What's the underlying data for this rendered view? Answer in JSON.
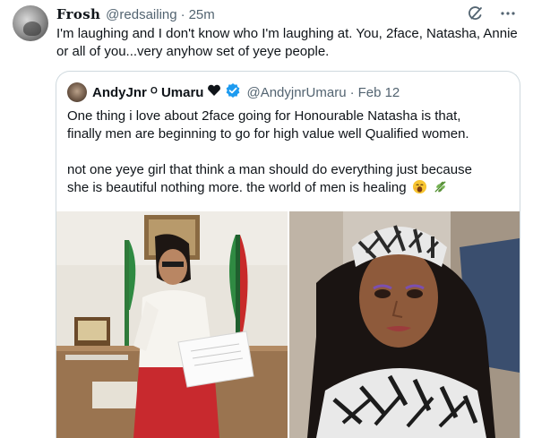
{
  "tweet": {
    "author_name": "Frosh",
    "handle": "@redsailing",
    "separator": "·",
    "time": "25m",
    "text": "I'm laughing and I don't know who I'm laughing at. You, 2face, Natasha, Annie or all of you...very anyhow set of yeye people."
  },
  "icons": {
    "grok": "grok-icon",
    "more": "more-options-icon",
    "verified": "verified-badge-icon",
    "verified_color": "#1d9bf0"
  },
  "quoted_tweet": {
    "author_name": "AndyJnr ᴼ Umaru",
    "handle": "@AndyjnrUmaru",
    "separator": "·",
    "date": "Feb 12",
    "paragraph1_line1": "One thing i love about 2face going for Honourable Natasha is that,",
    "paragraph1_line2": "finally men are beginning to go for high value well Qualified women.",
    "paragraph2_line1": "not one yeye girl that think a man should do everything just because",
    "paragraph2_line2": "she is beautiful nothing more. the world of men is healing",
    "emojis": [
      "yawning-face-emoji",
      "herb-emoji"
    ]
  },
  "photos": [
    {
      "name": "photo-woman-reading-document",
      "description": "Woman in white blouse and red skirt reading a paper in an office"
    },
    {
      "name": "photo-woman-headwrap-portrait",
      "description": "Woman in black and white patterned headwrap"
    }
  ]
}
